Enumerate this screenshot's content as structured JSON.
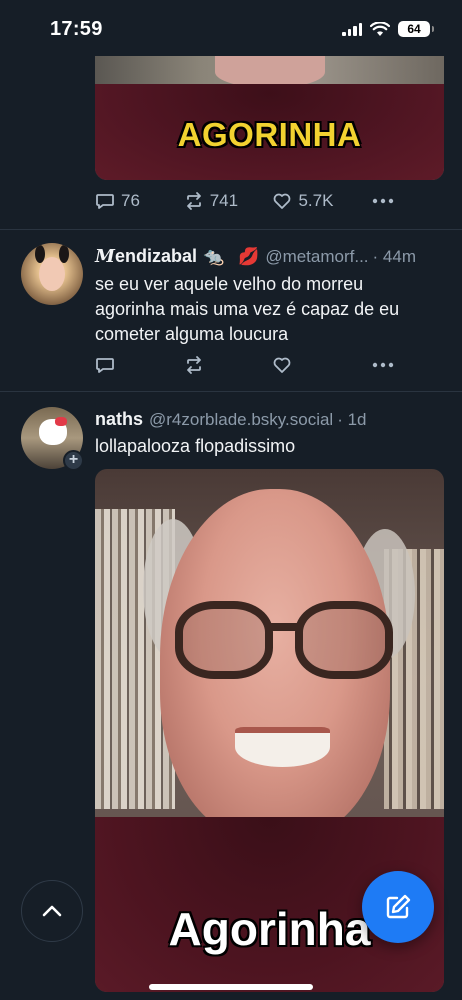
{
  "status_bar": {
    "time": "17:59",
    "battery": "64"
  },
  "post_prev": {
    "media_caption": "AGORINHA",
    "reply_count": "76",
    "repost_count": "741",
    "like_count": "5.7K"
  },
  "post_1": {
    "display_name_initial": "M",
    "display_name_rest": "endizabal",
    "emojis": [
      "🐀",
      "💋"
    ],
    "handle": "@metamorf...",
    "time": "· 44m",
    "text": "se eu ver aquele velho do morreu agorinha mais uma vez é capaz de eu cometer alguma loucura"
  },
  "post_2": {
    "display_name": "naths",
    "handle": "@r4zorblade.bsky.social",
    "time": "· 1d",
    "text": "lollapalooza flopadissimo",
    "media_caption": "Agorinha"
  },
  "icons": {
    "reply": "reply-icon",
    "repost": "repost-icon",
    "like": "heart-icon",
    "more": "more-icon",
    "scroll_top": "chevron-up-icon",
    "compose": "compose-icon"
  },
  "colors": {
    "background": "#161e27",
    "accent": "#1e7bf5",
    "muted": "#8c9aa9"
  }
}
